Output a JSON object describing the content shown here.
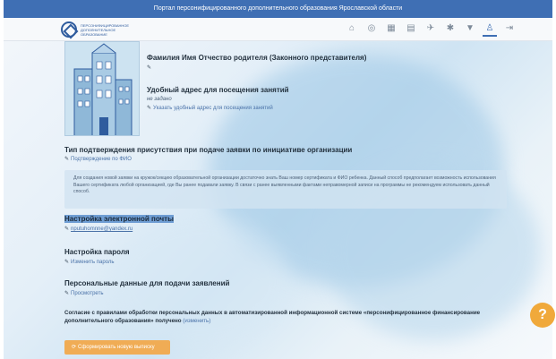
{
  "topbar": {
    "title": "Портал персонифицированного дополнительного образования Ярославской области"
  },
  "navbar": {
    "logo_text": "ПЕРСОНИФИЦИРОВАННОЕ ДОПОЛНИТЕЛЬНОЕ ОБРАЗОВАНИЕ",
    "icons": [
      {
        "name": "home-icon",
        "glyph": "⌂"
      },
      {
        "name": "search-icon",
        "glyph": "◎"
      },
      {
        "name": "catalog-icon",
        "glyph": "▦"
      },
      {
        "name": "document-icon",
        "glyph": "▤"
      },
      {
        "name": "megaphone-icon",
        "glyph": "✈"
      },
      {
        "name": "settings-icon",
        "glyph": "✱"
      },
      {
        "name": "filter-icon",
        "glyph": "▼"
      },
      {
        "name": "user-icon",
        "glyph": "♙"
      },
      {
        "name": "logout-icon",
        "glyph": "⇥"
      }
    ]
  },
  "profile": {
    "parent_name": "Фамилия Имя Отчество родителя (Законного представителя)",
    "address_title": "Удобный адрес для посещения занятий",
    "address_value": "не задано",
    "address_link": "Указать удобный адрес для посещения занятий"
  },
  "confirmation": {
    "title": "Тип подтверждения присутствия при подаче заявки по инициативе организации",
    "link": "Подтверждение по ФИО"
  },
  "info_text": "Для создания новой заявки на кружок/секцию образовательной организации достаточно знать Ваш номер сертификата и ФИО ребенка. Данный способ предполагает возможность использования Вашего сертификата любой организацией, где Вы ранее подавали заявку. В связи с ранее выявленными фактами неправомерной записи на программы не рекомендуем использовать данный способ.",
  "email": {
    "title": "Настройка электронной почты",
    "value": "nputuhomnne@yandex.ru"
  },
  "password": {
    "title": "Настройка пароля",
    "link": "Изменить пароль"
  },
  "personal_data": {
    "title": "Персональные данные для подачи заявлений",
    "link": "Просмотреть"
  },
  "consent": {
    "text": "Согласие с правилами обработки персональных данных в автоматизированной информационной системе «персонифицированное финансирование дополнительного образования»",
    "status": "получено",
    "change_link": "(изменить)"
  },
  "button_label": "Сформировать новую выписку",
  "help_glyph": "?"
}
